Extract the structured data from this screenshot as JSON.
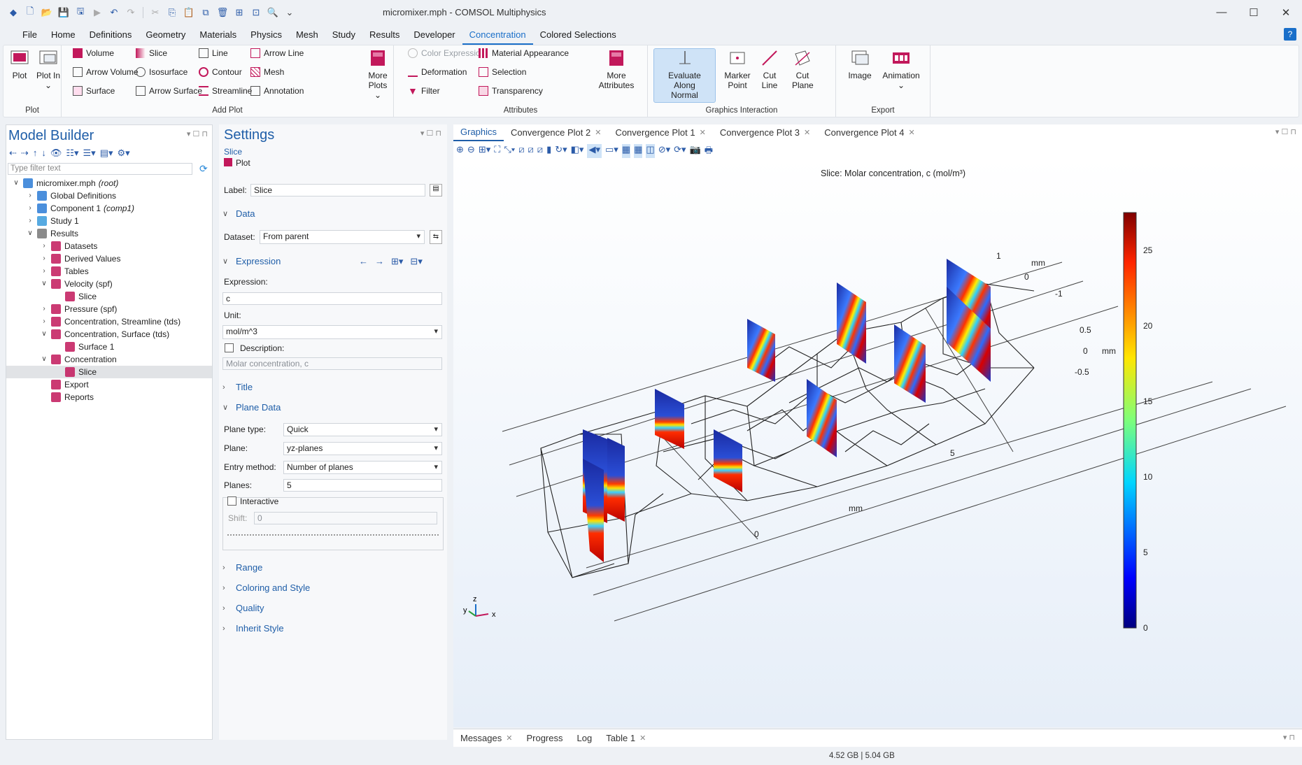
{
  "window": {
    "title": "micromixer.mph - COMSOL Multiphysics"
  },
  "menus": [
    "File",
    "Home",
    "Definitions",
    "Geometry",
    "Materials",
    "Physics",
    "Mesh",
    "Study",
    "Results",
    "Developer",
    "Concentration",
    "Colored Selections"
  ],
  "ribbon": {
    "plot_group": {
      "label": "Plot",
      "plot": "Plot",
      "plot_in": "Plot In"
    },
    "add_plot": {
      "label": "Add Plot",
      "volume": "Volume",
      "arrow_volume": "Arrow Volume",
      "surface": "Surface",
      "slice": "Slice",
      "isosurface": "Isosurface",
      "arrow_surface": "Arrow Surface",
      "line": "Line",
      "contour": "Contour",
      "streamline": "Streamline",
      "arrow_line": "Arrow Line",
      "mesh": "Mesh",
      "annotation": "Annotation",
      "more_plots": "More Plots"
    },
    "attributes": {
      "label": "Attributes",
      "color_expression": "Color Expression",
      "deformation": "Deformation",
      "filter": "Filter",
      "material_appearance": "Material Appearance",
      "selection": "Selection",
      "transparency": "Transparency",
      "more_attributes": "More Attributes"
    },
    "graphics_interaction": {
      "label": "Graphics Interaction",
      "evaluate": "Evaluate Along Normal",
      "marker": "Marker Point",
      "cut_line": "Cut Line",
      "cut_plane": "Cut Plane"
    },
    "export": {
      "label": "Export",
      "image": "Image",
      "animation": "Animation"
    }
  },
  "model_builder": {
    "title": "Model Builder",
    "filter_placeholder": "Type filter text",
    "tree": [
      {
        "label": "micromixer.mph",
        "suffix": "(root)",
        "level": 0,
        "exp": "v",
        "icon": "#2b7bd6"
      },
      {
        "label": "Global Definitions",
        "level": 1,
        "exp": ">",
        "icon": "#2b7bd6"
      },
      {
        "label": "Component 1",
        "suffix": "(comp1)",
        "level": 1,
        "exp": ">",
        "icon": "#2b7bd6"
      },
      {
        "label": "Study 1",
        "level": 1,
        "exp": ">",
        "icon": "#3a9bdc"
      },
      {
        "label": "Results",
        "level": 1,
        "exp": "v",
        "icon": "#777"
      },
      {
        "label": "Datasets",
        "level": 2,
        "exp": ">",
        "icon": "#c2185b"
      },
      {
        "label": "Derived Values",
        "level": 2,
        "exp": ">",
        "icon": "#c2185b"
      },
      {
        "label": "Tables",
        "level": 2,
        "exp": ">",
        "icon": "#c2185b"
      },
      {
        "label": "Velocity (spf)",
        "level": 2,
        "exp": "v",
        "icon": "#c2185b"
      },
      {
        "label": "Slice",
        "level": 3,
        "exp": "",
        "icon": "#c2185b"
      },
      {
        "label": "Pressure (spf)",
        "level": 2,
        "exp": ">",
        "icon": "#c2185b"
      },
      {
        "label": "Concentration, Streamline (tds)",
        "level": 2,
        "exp": ">",
        "icon": "#c2185b"
      },
      {
        "label": "Concentration, Surface (tds)",
        "level": 2,
        "exp": "v",
        "icon": "#c2185b"
      },
      {
        "label": "Surface 1",
        "level": 3,
        "exp": "",
        "icon": "#c2185b"
      },
      {
        "label": "Concentration",
        "level": 2,
        "exp": "v",
        "icon": "#c2185b"
      },
      {
        "label": "Slice",
        "level": 3,
        "exp": "",
        "icon": "#c2185b",
        "selected": true
      },
      {
        "label": "Export",
        "level": 2,
        "exp": "",
        "icon": "#c2185b"
      },
      {
        "label": "Reports",
        "level": 2,
        "exp": "",
        "icon": "#c2185b"
      }
    ]
  },
  "settings": {
    "title": "Settings",
    "node_type": "Slice",
    "node_sub": "Plot",
    "label_caption": "Label:",
    "label_value": "Slice",
    "data_section": "Data",
    "dataset_caption": "Dataset:",
    "dataset_value": "From parent",
    "expression_section": "Expression",
    "expression_caption": "Expression:",
    "expression_value": "c",
    "unit_caption": "Unit:",
    "unit_value": "mol/m^3",
    "description_caption": "Description:",
    "description_value": "Molar concentration, c",
    "title_section": "Title",
    "plane_section": "Plane Data",
    "plane_type_caption": "Plane type:",
    "plane_type_value": "Quick",
    "plane_caption": "Plane:",
    "plane_value": "yz-planes",
    "entry_caption": "Entry method:",
    "entry_value": "Number of planes",
    "planes_caption": "Planes:",
    "planes_value": "5",
    "interactive_caption": "Interactive",
    "shift_caption": "Shift:",
    "shift_value": "0",
    "range_section": "Range",
    "coloring_section": "Coloring and Style",
    "quality_section": "Quality",
    "inherit_section": "Inherit Style"
  },
  "graphics": {
    "tabs": [
      {
        "label": "Graphics",
        "active": true
      },
      {
        "label": "Convergence Plot 2",
        "close": true
      },
      {
        "label": "Convergence Plot 1",
        "close": true
      },
      {
        "label": "Convergence Plot 3",
        "close": true
      },
      {
        "label": "Convergence Plot 4",
        "close": true
      }
    ],
    "plot_title": "Slice: Molar concentration, c (mol/m³)",
    "colorbar_ticks": [
      "25",
      "20",
      "15",
      "10",
      "5",
      "0"
    ],
    "axis_labels": {
      "mm_top": "mm",
      "z1": "1",
      "z0": "0",
      "zm1": "-1",
      "y05": "0.5",
      "y0": "0",
      "ym05": "-0.5",
      "mm_right": "mm",
      "x5": "5",
      "x0": "0",
      "mm_bottom": "mm"
    },
    "triad": {
      "x": "x",
      "y": "y",
      "z": "z"
    }
  },
  "bottom_tabs": [
    {
      "label": "Messages",
      "close": true
    },
    {
      "label": "Progress"
    },
    {
      "label": "Log"
    },
    {
      "label": "Table 1",
      "close": true
    }
  ],
  "status": {
    "memory": "4.52 GB | 5.04 GB"
  }
}
